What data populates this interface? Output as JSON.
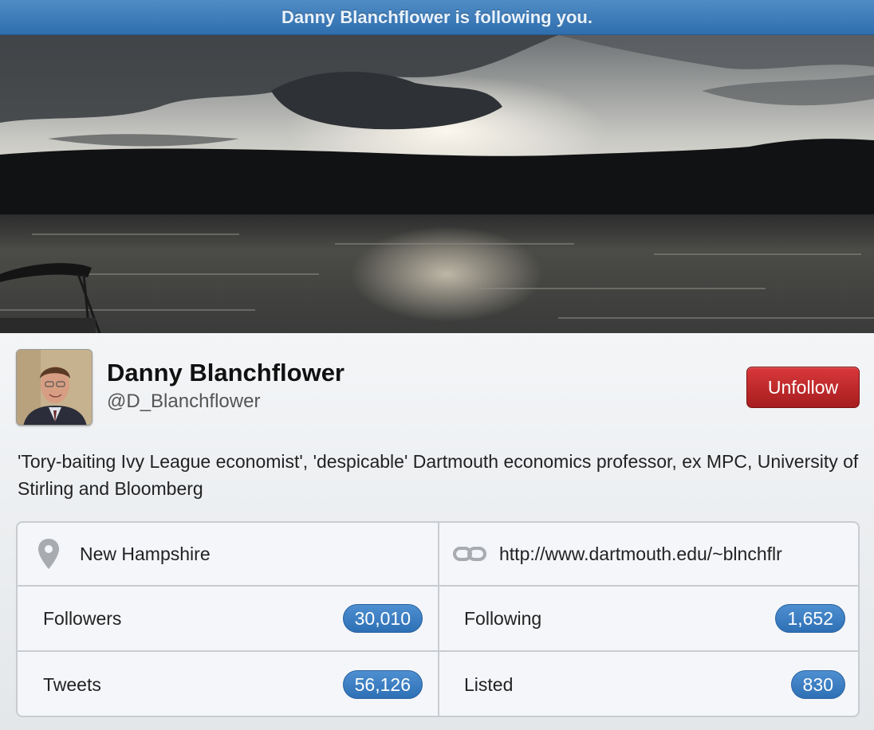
{
  "banner": {
    "text": "Danny Blanchflower is following you."
  },
  "profile": {
    "name": "Danny Blanchflower",
    "handle": "@D_Blanchflower",
    "bio": "'Tory-baiting Ivy League economist', 'despicable' Dartmouth economics professor, ex MPC, University of Stirling and Bloomberg",
    "unfollow_label": "Unfollow",
    "unfollow_color": "#c0292b"
  },
  "details": {
    "location": "New Hampshire",
    "website": "http://www.dartmouth.edu/~blnchflr"
  },
  "stats": {
    "followers_label": "Followers",
    "followers_value": "30,010",
    "following_label": "Following",
    "following_value": "1,652",
    "tweets_label": "Tweets",
    "tweets_value": "56,126",
    "listed_label": "Listed",
    "listed_value": "830"
  },
  "icons": {
    "location": "map-pin-icon",
    "website": "link-icon"
  },
  "colors": {
    "banner": "#3b7bbd",
    "badge": "#3a7fc4"
  }
}
